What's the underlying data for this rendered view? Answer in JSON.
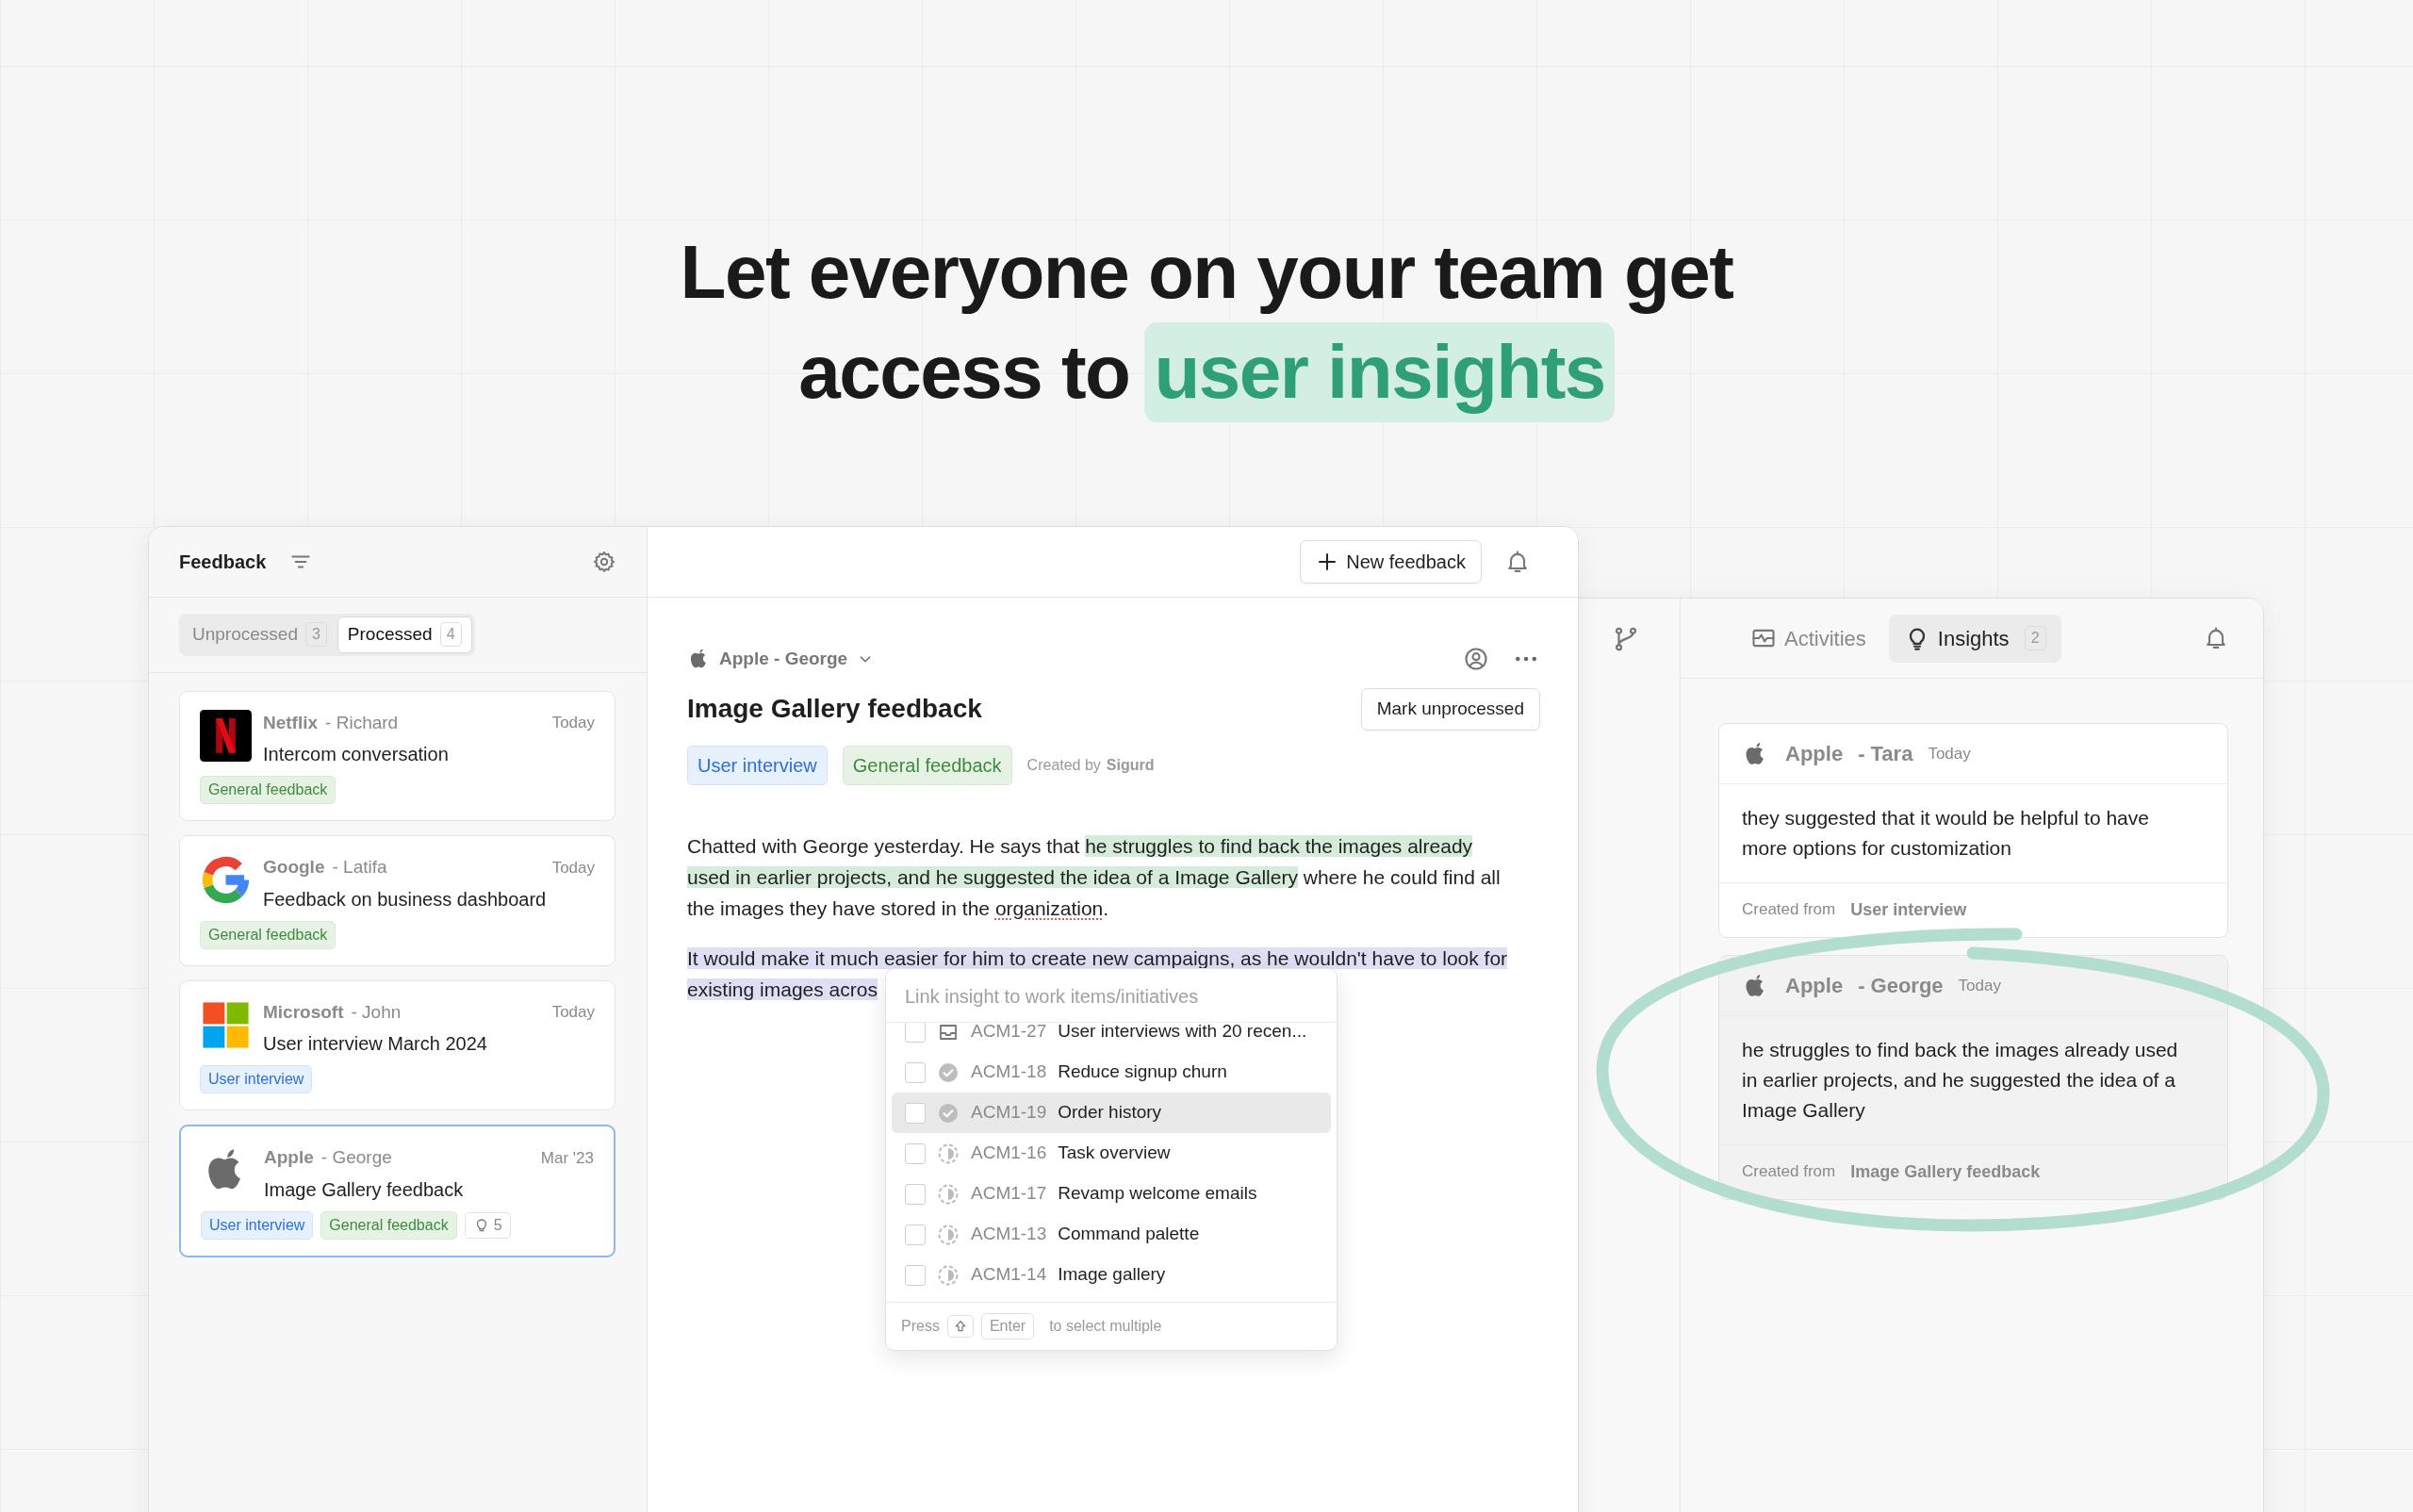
{
  "heading": {
    "lines": [
      [
        {
          "text": "Let everyone on your team get",
          "highlight": false
        }
      ],
      [
        {
          "text": "access to",
          "highlight": false
        },
        {
          "text": "user insights",
          "highlight": true
        }
      ]
    ]
  },
  "feedback_panel": {
    "title": "Feedback",
    "tabs": [
      {
        "label": "Unprocessed",
        "count": "3",
        "selected": false
      },
      {
        "label": "Processed",
        "count": "4",
        "selected": true
      }
    ],
    "items": [
      {
        "kind": "netflix",
        "company": "Netflix",
        "author": "- Richard",
        "date": "Today",
        "title": "Intercom conversation",
        "tags": [
          {
            "label": "General feedback",
            "kind": "general"
          }
        ],
        "selected": false
      },
      {
        "kind": "google",
        "company": "Google",
        "author": "- Latifa",
        "date": "Today",
        "title": "Feedback on business dashboard",
        "tags": [
          {
            "label": "General feedback",
            "kind": "general"
          }
        ],
        "selected": false
      },
      {
        "kind": "microsoft",
        "company": "Microsoft",
        "author": "- John",
        "date": "Today",
        "title": "User interview March 2024",
        "tags": [
          {
            "label": "User interview",
            "kind": "interview"
          }
        ],
        "selected": false
      },
      {
        "kind": "apple",
        "company": "Apple",
        "author": "- George",
        "date": "Mar '23",
        "title": "Image Gallery feedback",
        "tags": [
          {
            "label": "User interview",
            "kind": "interview"
          },
          {
            "label": "General feedback",
            "kind": "general"
          }
        ],
        "insights": "5",
        "selected": true
      }
    ]
  },
  "detail": {
    "new_button": "New feedback",
    "source": "Apple - George",
    "title": "Image Gallery feedback",
    "status_button": "Mark unprocessed",
    "tags": [
      {
        "label": "User interview",
        "kind": "interview"
      },
      {
        "label": "General feedback",
        "kind": "general"
      }
    ],
    "created_by_label": "Created by",
    "created_by": "Sigurd",
    "paragraphs": [
      [
        {
          "text": "Chatted with George yesterday. He says that ",
          "kind": "plain"
        },
        {
          "text": "he struggles to find back the images already used in earlier projects, and he suggested the idea of a Image Gallery",
          "kind": "insight"
        },
        {
          "text": " where he could find all the images they have stored in the ",
          "kind": "plain"
        },
        {
          "text": "organization",
          "kind": "misspelled"
        },
        {
          "text": ".",
          "kind": "plain"
        }
      ],
      [
        {
          "text": "It would make it much easier for him to create new campaigns, as he wouldn't have to look for existing images acros",
          "kind": "selected"
        }
      ]
    ]
  },
  "link_popup": {
    "placeholder": "Link insight to work items/initiatives",
    "items": [
      {
        "kind": "backlog",
        "id": "ACM1-27",
        "title": "User interviews with 20 recen...",
        "checked": false,
        "highlighted": false
      },
      {
        "kind": "done",
        "id": "ACM1-18",
        "title": "Reduce signup churn",
        "checked": false,
        "highlighted": false
      },
      {
        "kind": "done",
        "id": "ACM1-19",
        "title": "Order history",
        "checked": false,
        "highlighted": true
      },
      {
        "kind": "in_progress",
        "id": "ACM1-16",
        "title": "Task overview",
        "checked": false,
        "highlighted": false
      },
      {
        "kind": "in_progress",
        "id": "ACM1-17",
        "title": "Revamp welcome emails",
        "checked": false,
        "highlighted": false
      },
      {
        "kind": "in_progress",
        "id": "ACM1-13",
        "title": "Command palette",
        "checked": false,
        "highlighted": false
      },
      {
        "kind": "in_progress",
        "id": "ACM1-14",
        "title": "Image gallery",
        "checked": false,
        "highlighted": false
      }
    ],
    "footer": {
      "press": "Press",
      "key": "Enter",
      "hint": "to select multiple"
    }
  },
  "insights_panel": {
    "tabs": [
      {
        "label": "Activities",
        "kind": "activity",
        "selected": false
      },
      {
        "label": "Insights",
        "kind": "bulb",
        "count": "2",
        "selected": true
      }
    ],
    "cards": [
      {
        "company": "Apple",
        "author": "- Tara",
        "date": "Today",
        "text": "they suggested that it would be helpful to have more options for customization",
        "created_label": "Created from",
        "source": "User interview",
        "selected": false
      },
      {
        "company": "Apple",
        "author": "- George",
        "date": "Today",
        "text": "he struggles to find back the images already used in earlier projects, and he suggested the idea of a Image Gallery",
        "created_label": "Created from",
        "source": "Image Gallery feedback",
        "selected": true
      }
    ]
  }
}
